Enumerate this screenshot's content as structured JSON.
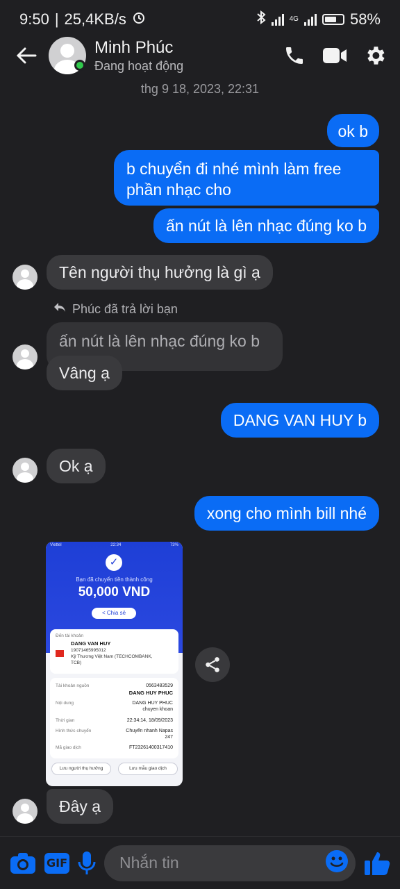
{
  "status": {
    "time": "9:50",
    "speed": "25,4KB/s",
    "network": "4G",
    "battery": "58%"
  },
  "header": {
    "name": "Minh Phúc",
    "status": "Đang hoạt động"
  },
  "timestamp": "thg 9 18, 2023, 22:31",
  "messages": {
    "m1": "ok b",
    "m2_line1": "b chuyển đi nhé mình làm free",
    "m2_line2": "phần nhạc cho",
    "m3": "ấn nút là lên nhạc đúng ko b",
    "m4": "Tên người thụ hưởng là gì ạ",
    "reply_note": "Phúc đã trả lời bạn",
    "quoted": "ấn nút là lên nhạc đúng ko b",
    "m5": "Vâng ạ",
    "m6": "DANG VAN HUY b",
    "m7": "Ok ạ",
    "m8": "xong cho mình bill nhé",
    "m9": "Đây ạ"
  },
  "bill": {
    "carrier": "Viettel",
    "time": "22:34",
    "battery": "73%",
    "done_text": "Bạn đã chuyển tiền thành công",
    "amount": "50,000 VND",
    "share": "Chia sẻ",
    "to_label": "Đến tài khoản",
    "to_name": "DANG VAN HUY",
    "to_account": "19071465995012",
    "to_bank_1": "Kỹ Thương Việt Nam (TECHCOMBANK,",
    "to_bank_2": "TCB)",
    "source_label": "Tài khoản nguồn",
    "source_account": "0563483529",
    "source_name": "DANG HUY PHUC",
    "content_label": "Nội dung",
    "content_1": "DANG HUY PHUC",
    "content_2": "chuyen khoan",
    "time_label": "Thời gian",
    "time_value": "22:34:14, 18/09/2023",
    "method_label": "Hình thức chuyển",
    "method_1": "Chuyển nhanh Napas",
    "method_2": "247",
    "code_label": "Mã giao dịch",
    "code_value": "FT23261400317410",
    "btn_save_recipient": "Lưu người thụ hưởng",
    "btn_save_template": "Lưu mẫu giao dịch"
  },
  "composer": {
    "gif_label": "GIF",
    "placeholder": "Nhắn tin"
  },
  "colors": {
    "outgoing": "#0a6cf5",
    "incoming": "#3a3a3d",
    "background": "#1f1f22",
    "online": "#31c94c"
  }
}
